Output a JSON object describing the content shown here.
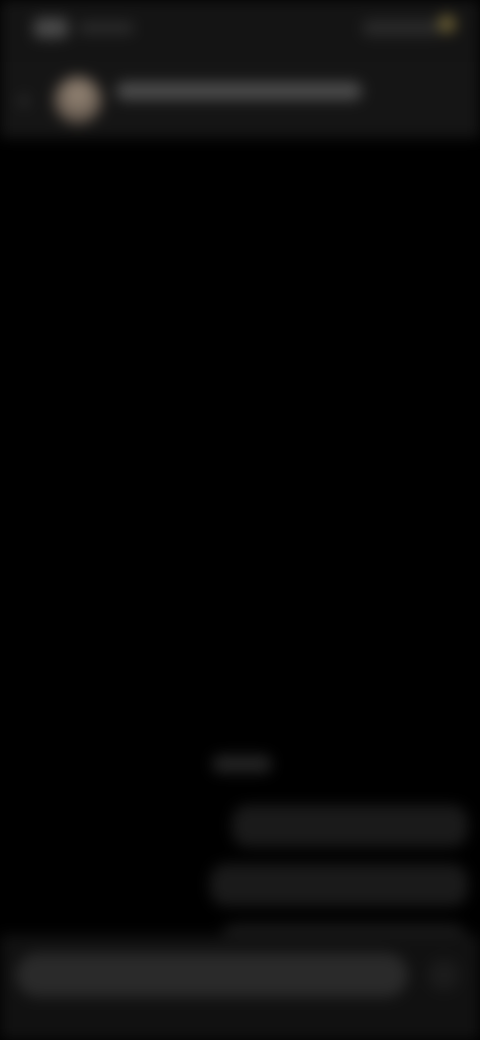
{
  "statusbar": {
    "time": "",
    "right_label": ""
  },
  "header": {
    "contact_name": ""
  },
  "chat": {
    "date_separator": "",
    "messages": [
      "",
      "",
      "",
      ""
    ],
    "status_text": ""
  },
  "composer": {
    "placeholder": ""
  },
  "colors": {
    "background": "#000000",
    "header_background": "#151515",
    "bubble": "#1a1a1a",
    "accent": "#5f5320"
  },
  "icons": {
    "back": "back-arrow-icon",
    "read_receipt": "read-receipt-icon",
    "composer_action": "send-icon"
  }
}
